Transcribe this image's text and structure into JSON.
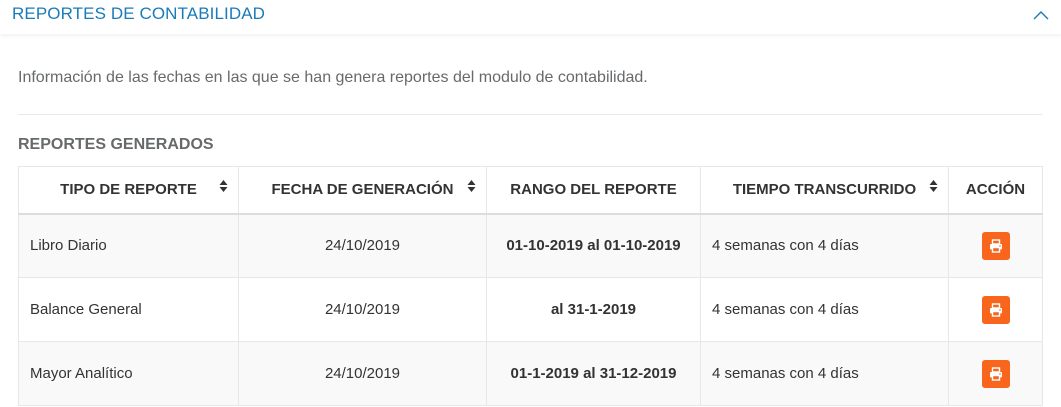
{
  "panel": {
    "title": "REPORTES DE CONTABILIDAD",
    "collapse_icon": "chevron-up-icon"
  },
  "description": "Información de las fechas en las que se han genera reportes del modulo de contabilidad.",
  "section_title": "REPORTES GENERADOS",
  "colors": {
    "title_blue": "#1a7bb9",
    "action_orange": "#f8661e",
    "muted_text": "#676a6c"
  },
  "table": {
    "headers": {
      "tipo": "TIPO DE REPORTE",
      "fecha": "FECHA DE GENERACIÓN",
      "rango": "RANGO DEL REPORTE",
      "tiempo": "TIEMPO TRANSCURRIDO",
      "accion": "ACCIÓN"
    },
    "rows": [
      {
        "tipo": "Libro Diario",
        "fecha": "24/10/2019",
        "rango": "01-10-2019 al 01-10-2019",
        "tiempo": "4 semanas con 4 días",
        "action_icon": "print-icon"
      },
      {
        "tipo": "Balance General",
        "fecha": "24/10/2019",
        "rango": "al 31-1-2019",
        "tiempo": "4 semanas con 4 días",
        "action_icon": "print-icon"
      },
      {
        "tipo": "Mayor Analítico",
        "fecha": "24/10/2019",
        "rango": "01-1-2019 al 31-12-2019",
        "tiempo": "4 semanas con 4 días",
        "action_icon": "print-icon"
      }
    ]
  }
}
